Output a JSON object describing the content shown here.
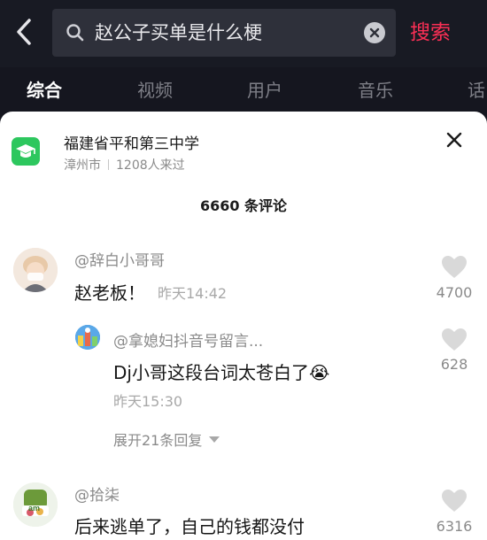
{
  "search": {
    "query": "赵公子买单是什么梗",
    "submit_label": "搜索"
  },
  "tabs": [
    {
      "label": "综合",
      "active": true
    },
    {
      "label": "视频",
      "active": false
    },
    {
      "label": "用户",
      "active": false
    },
    {
      "label": "音乐",
      "active": false
    },
    {
      "label": "话",
      "active": false
    }
  ],
  "location": {
    "name": "福建省平和第三中学",
    "city": "漳州市",
    "visitors": "1208人来过"
  },
  "comments_header": "6660 条评论",
  "comments": [
    {
      "username": "@辞白小哥哥",
      "text": "赵老板！",
      "time": "昨天14:42",
      "likes": "4700"
    },
    {
      "username": "@拿媳妇抖音号留言...",
      "text": "Dj小哥这段台词太苍白了",
      "time": "昨天15:30",
      "likes": "628",
      "emoji": "😭"
    },
    {
      "username": "@拾柒",
      "text": "后来逃单了，自己的钱都没付",
      "likes": "6316"
    }
  ],
  "expand_replies_label": "展开21条回复",
  "colors": {
    "accent": "#fb2f55",
    "location_icon": "#2dc75e",
    "top_bg": "#181a23"
  }
}
